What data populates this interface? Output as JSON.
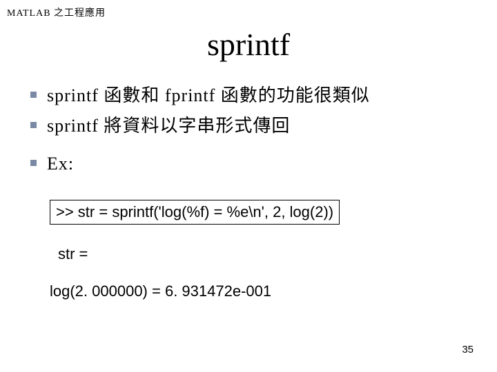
{
  "header": "MATLAB   之工程應用",
  "title": "sprintf",
  "bullets": [
    "sprintf 函數和 fprintf 函數的功能很類似",
    "sprintf 將資料以字串形式傳回",
    "Ex:"
  ],
  "code": {
    "cmd": ">> str = sprintf('log(%f) = %e\\n', 2, log(2))",
    "out1": "str =",
    "out2": "log(2. 000000) = 6. 931472e-001"
  },
  "page": "35"
}
